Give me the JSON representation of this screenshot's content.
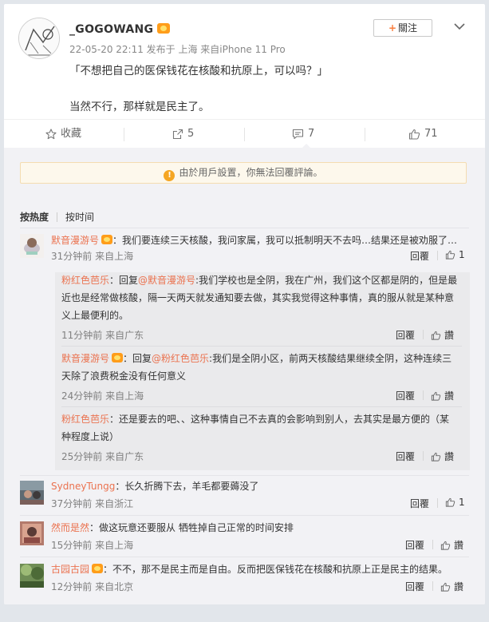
{
  "post": {
    "username": "_GOGOWANG",
    "meta": "22-05-20 22:11 发布于 上海 来自iPhone 11 Pro",
    "follow_label": "關注",
    "text_line1": "「不想把自己的医保钱花在核酸和抗原上，可以吗？」",
    "text_line2": "当然不行，那样就是民主了。"
  },
  "actions": {
    "favorite": "收藏",
    "repost": "5",
    "comment": "7",
    "like": "71"
  },
  "notice": "由於用戶設置，你無法回覆評論。",
  "sort": {
    "hot": "按热度",
    "time": "按时间"
  },
  "comments": [
    {
      "user": "默音漫游号",
      "text": "：我们要连续三天核酸，我问家属，我可以抵制明天不去吗…结果还是被劝服了…",
      "meta": "31分钟前 来自上海",
      "reply": "回覆",
      "likes": "1"
    },
    {
      "user": "SydneyTungg",
      "text": "：长久折腾下去，羊毛都要薅没了",
      "meta": "37分钟前 来自浙江",
      "reply": "回覆",
      "likes": "1"
    },
    {
      "user": "然而是然",
      "text": "：做这玩意还要服从 牺牲掉自己正常的时间安排",
      "meta": "15分钟前 来自上海",
      "reply": "回覆",
      "likes": "讚"
    },
    {
      "user": "古园古园",
      "text": "：不不，那不是民主而是自由。反而把医保钱花在核酸和抗原上正是民主的结果。",
      "meta": "12分钟前 来自北京",
      "reply": "回覆",
      "likes": "讚"
    }
  ],
  "replies": [
    {
      "user": "粉红色芭乐",
      "prefix": "：回复",
      "mention": "@默音漫游号",
      "line1": ":我们学校也是全阴，我在广州，我们这个区都是阴的，但是最",
      "line2": "近也是经常做核酸，隔一天两天就发通知要去做，其实我觉得这种事情，真的服从就是某种意",
      "line3": "义上最便利的。",
      "meta": "11分钟前 来自广东",
      "reply": "回覆",
      "likes": "讚"
    },
    {
      "user": "默音漫游号",
      "prefix": "：回复",
      "mention": "@粉红色芭乐",
      "line1": ":我们是全阴小区，前两天核酸结果继续全阴，这种连续三",
      "line2": "天除了浪费税金没有任何意义",
      "meta": "24分钟前 来自上海",
      "reply": "回覆",
      "likes": "讚"
    },
    {
      "user": "粉红色芭乐",
      "line1": "：还是要去的吧、、这种事情自己不去真的会影响到别人，去其实是最方便的（某",
      "line2": "种程度上说）",
      "meta": "25分钟前 来自广东",
      "reply": "回覆",
      "likes": "讚"
    }
  ]
}
